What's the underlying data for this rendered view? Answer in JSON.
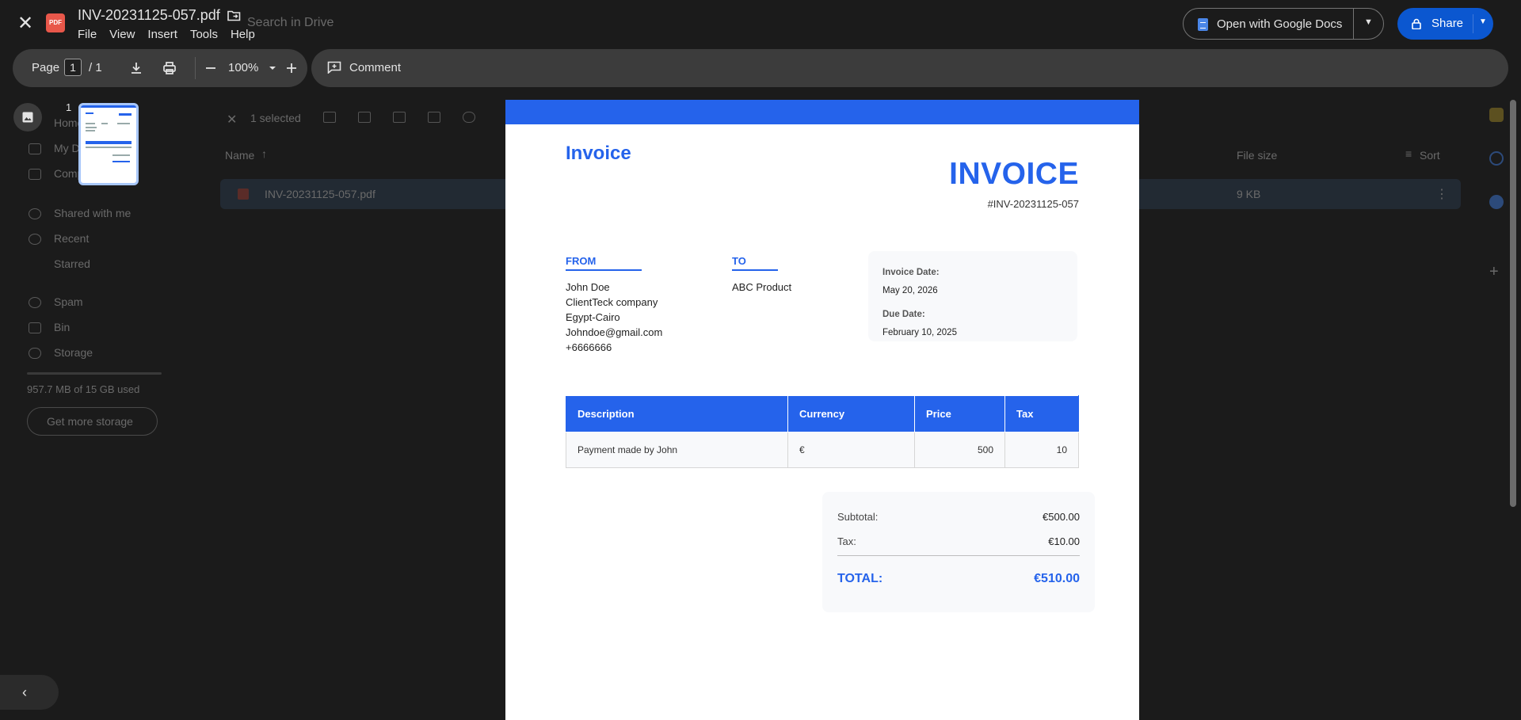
{
  "drive_background": {
    "search_placeholder": "Search in Drive",
    "nav": [
      "Home",
      "My Drive",
      "Computers",
      "Shared with me",
      "Recent",
      "Starred",
      "Spam",
      "Bin",
      "Storage"
    ],
    "storage_used": "957.7 MB of 15 GB used",
    "get_storage": "Get more storage",
    "selection": "1 selected",
    "col_name": "Name",
    "col_file_size": "File size",
    "sort": "Sort",
    "row_name": "INV-20231125-057.pdf",
    "row_size": "9 KB"
  },
  "topbar": {
    "title": "INV-20231125-057.pdf",
    "pdf_badge": "PDF",
    "menu": [
      "File",
      "View",
      "Insert",
      "Tools",
      "Help"
    ],
    "open_with": "Open with Google Docs",
    "share": "Share"
  },
  "pdf_toolbar": {
    "page_label": "Page",
    "page_current": "1",
    "page_total": "/ 1",
    "zoom": "100%",
    "comment": "Comment"
  },
  "thumbnails": {
    "page_number": "1"
  },
  "invoice": {
    "heading_small": "Invoice",
    "heading_big": "INVOICE",
    "number": "#INV-20231125-057",
    "from_label": "FROM",
    "from_lines": [
      "John Doe",
      "ClientTeck company",
      "Egypt-Cairo",
      "Johndoe@gmail.com",
      "+6666666"
    ],
    "to_label": "TO",
    "to_lines": [
      "ABC Product"
    ],
    "invoice_date_label": "Invoice Date:",
    "invoice_date": "May 20, 2026",
    "due_date_label": "Due Date:",
    "due_date": "February 10, 2025",
    "table": {
      "headers": [
        "Description",
        "Currency",
        "Price",
        "Tax"
      ],
      "rows": [
        [
          "Payment made by John",
          "€",
          "500",
          "10"
        ]
      ]
    },
    "subtotal_label": "Subtotal:",
    "subtotal": "€500.00",
    "tax_label": "Tax:",
    "tax": "€10.00",
    "total_label": "TOTAL:",
    "total": "€510.00"
  },
  "colors": {
    "accent": "#2563eb",
    "share": "#0b57d0",
    "toolbar": "#3c3c3c",
    "bg": "#1b1b1b"
  }
}
